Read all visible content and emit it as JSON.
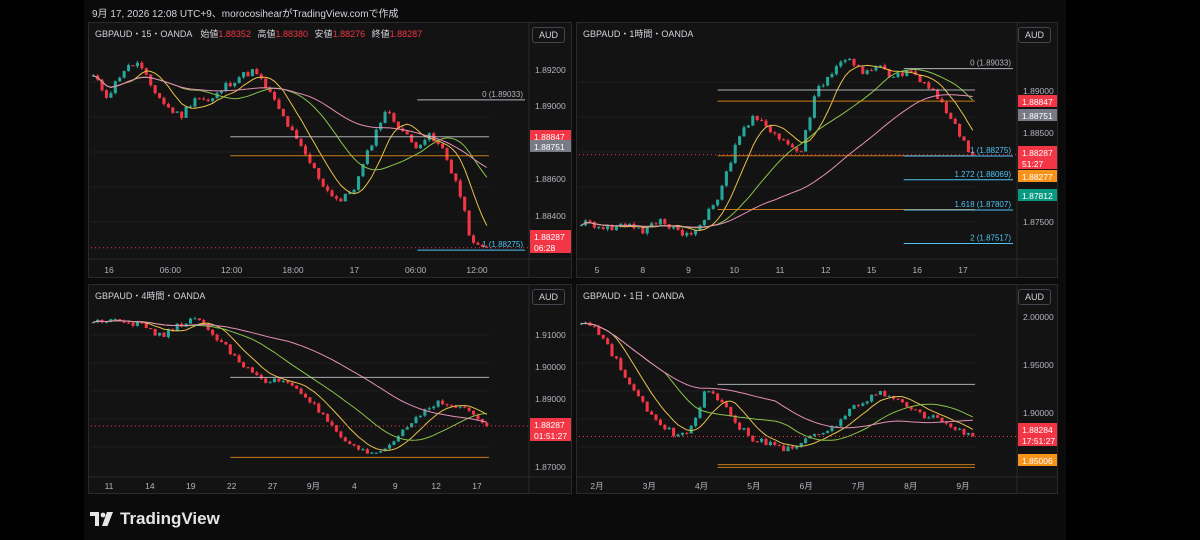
{
  "header": {
    "text": "9月 17, 2026 12:08 UTC+9、morocosihearがTradingView.comで作成"
  },
  "brand": {
    "name": "TradingView"
  },
  "colors": {
    "bg": "#131313",
    "grid": "#1f1f1f",
    "up": "#26a69a",
    "down": "#f23645",
    "price_red": "#f23645",
    "gray_label": "#787b86",
    "orange": "#f7931a",
    "ma_yellow": "#e8c14a",
    "ma_green": "#8bc34a",
    "ma_pink": "#e58fb8",
    "ma_purple": "#9c27b0",
    "fib_blue": "#4fc3f7",
    "white_line": "#d1d4dc"
  },
  "panels": [
    {
      "id": "p15",
      "title": "GBPAUD・15・OANDA",
      "ohlc": [
        {
          "label": "始値",
          "value": "1.88352"
        },
        {
          "label": "高値",
          "value": "1.88380"
        },
        {
          "label": "安値",
          "value": "1.88276"
        },
        {
          "label": "終値",
          "value": "1.88287"
        }
      ],
      "currency": "AUD",
      "y_ticks": [
        "1.89200",
        "1.89000",
        "1.88800",
        "1.88600",
        "1.88400"
      ],
      "x_ticks": [
        "16",
        "06:00",
        "12:00",
        "18:00",
        "17",
        "06:00",
        "12:00"
      ],
      "fib": [
        {
          "text": "0 (1.89033)"
        },
        {
          "text": "1 (1.88275)"
        }
      ],
      "price_tags": [
        {
          "text": "1.88847",
          "kind": "red"
        },
        {
          "text": "1.88751",
          "kind": "gray"
        },
        {
          "text": "1.88287",
          "kind": "red"
        },
        {
          "text": "06:28",
          "kind": "red"
        }
      ]
    },
    {
      "id": "p1h",
      "title": "GBPAUD・1時間・OANDA",
      "currency": "AUD",
      "y_ticks": [
        "1.89000",
        "1.88500",
        "1.87500"
      ],
      "x_ticks": [
        "5",
        "8",
        "9",
        "10",
        "11",
        "12",
        "15",
        "16",
        "17"
      ],
      "fib": [
        {
          "text": "0 (1.89033)"
        },
        {
          "text": "1 (1.88275)"
        },
        {
          "text": "1.272 (1.88069)"
        },
        {
          "text": "1.618 (1.87807)"
        },
        {
          "text": "2 (1.87517)"
        }
      ],
      "price_tags": [
        {
          "text": "1.88847",
          "kind": "red"
        },
        {
          "text": "1.88751",
          "kind": "gray"
        },
        {
          "text": "1.88287",
          "kind": "red"
        },
        {
          "text": "51:27",
          "kind": "red"
        },
        {
          "text": "1.88277",
          "kind": "orange"
        },
        {
          "text": "1.87812",
          "kind": "teal"
        }
      ]
    },
    {
      "id": "p4h",
      "title": "GBPAUD・4時間・OANDA",
      "currency": "AUD",
      "y_ticks": [
        "1.91000",
        "1.90000",
        "1.89000",
        "1.87000"
      ],
      "x_ticks": [
        "11",
        "14",
        "19",
        "22",
        "27",
        "9月",
        "4",
        "9",
        "12",
        "17"
      ],
      "price_tags": [
        {
          "text": "1.88287",
          "kind": "red"
        },
        {
          "text": "01:51:27",
          "kind": "red"
        }
      ]
    },
    {
      "id": "p1d",
      "title": "GBPAUD・1日・OANDA",
      "currency": "AUD",
      "y_ticks": [
        "2.00000",
        "1.95000",
        "1.90000"
      ],
      "x_ticks": [
        "2月",
        "3月",
        "4月",
        "5月",
        "6月",
        "7月",
        "8月",
        "9月"
      ],
      "price_tags": [
        {
          "text": "1.88284",
          "kind": "red"
        },
        {
          "text": "17:51:27",
          "kind": "red"
        },
        {
          "text": "1.85006",
          "kind": "orange"
        }
      ]
    }
  ],
  "chart_data": [
    {
      "type": "candlestick",
      "title": "GBPAUD・15・OANDA",
      "x_ticks": [
        "16",
        "06:00",
        "12:00",
        "18:00",
        "17",
        "06:00",
        "12:00"
      ],
      "ylim": [
        1.8824,
        1.893
      ],
      "path_close": [
        1.8915,
        1.8905,
        1.8918,
        1.8922,
        1.891,
        1.89,
        1.8895,
        1.8905,
        1.8902,
        1.891,
        1.8915,
        1.8918,
        1.8908,
        1.8895,
        1.8882,
        1.887,
        1.8858,
        1.8852,
        1.886,
        1.888,
        1.8898,
        1.889,
        1.888,
        1.8885,
        1.8878,
        1.886,
        1.883,
        1.8828
      ],
      "last_price": 1.88287,
      "fib_levels": [
        {
          "level": 0,
          "price": 1.89033
        },
        {
          "level": 1,
          "price": 1.88275
        }
      ],
      "lines": [
        1.88847,
        1.88751
      ]
    },
    {
      "type": "candlestick",
      "title": "GBPAUD・1時間・OANDA",
      "x_ticks": [
        "5",
        "8",
        "9",
        "10",
        "11",
        "12",
        "15",
        "16",
        "17"
      ],
      "ylim": [
        1.874,
        1.8922
      ],
      "path_close": [
        1.877,
        1.8768,
        1.8765,
        1.877,
        1.8762,
        1.8772,
        1.8765,
        1.8758,
        1.8775,
        1.88,
        1.8845,
        1.886,
        1.8852,
        1.884,
        1.883,
        1.8885,
        1.89,
        1.8915,
        1.8898,
        1.8905,
        1.8895,
        1.8902,
        1.8888,
        1.8875,
        1.885,
        1.8828
      ],
      "last_price": 1.88287,
      "fib_levels": [
        {
          "level": 0,
          "price": 1.89033
        },
        {
          "level": 1,
          "price": 1.88275
        },
        {
          "level": 1.272,
          "price": 1.88069
        },
        {
          "level": 1.618,
          "price": 1.87807
        },
        {
          "level": 2,
          "price": 1.87517
        }
      ],
      "lines": [
        1.88847,
        1.88751,
        1.88277,
        1.87812
      ]
    },
    {
      "type": "candlestick",
      "title": "GBPAUD・4時間・OANDA",
      "x_ticks": [
        "11",
        "14",
        "19",
        "22",
        "27",
        "9月",
        "4",
        "9",
        "12",
        "17"
      ],
      "ylim": [
        1.869,
        1.9165
      ],
      "path_close": [
        1.912,
        1.9135,
        1.9125,
        1.911,
        1.908,
        1.9115,
        1.913,
        1.909,
        1.904,
        1.899,
        1.895,
        1.896,
        1.8935,
        1.888,
        1.882,
        1.877,
        1.875,
        1.876,
        1.881,
        1.886,
        1.8895,
        1.8885,
        1.887,
        1.8829
      ],
      "last_price": 1.88287,
      "lines": [
        1.8966,
        1.874
      ]
    },
    {
      "type": "candlestick",
      "title": "GBPAUD・1日・OANDA",
      "x_ticks": [
        "2月",
        "3月",
        "4月",
        "5月",
        "6月",
        "7月",
        "8月",
        "9月"
      ],
      "ylim": [
        1.842,
        2.02
      ],
      "path_close": [
        2.005,
        1.995,
        1.97,
        1.94,
        1.915,
        1.895,
        1.885,
        1.89,
        1.935,
        1.92,
        1.895,
        1.88,
        1.875,
        1.87,
        1.875,
        1.885,
        1.89,
        1.91,
        1.92,
        1.93,
        1.925,
        1.91,
        1.905,
        1.9,
        1.89,
        1.8828
      ],
      "last_price": 1.88284,
      "lines": [
        1.938,
        1.85006,
        1.853
      ]
    }
  ]
}
